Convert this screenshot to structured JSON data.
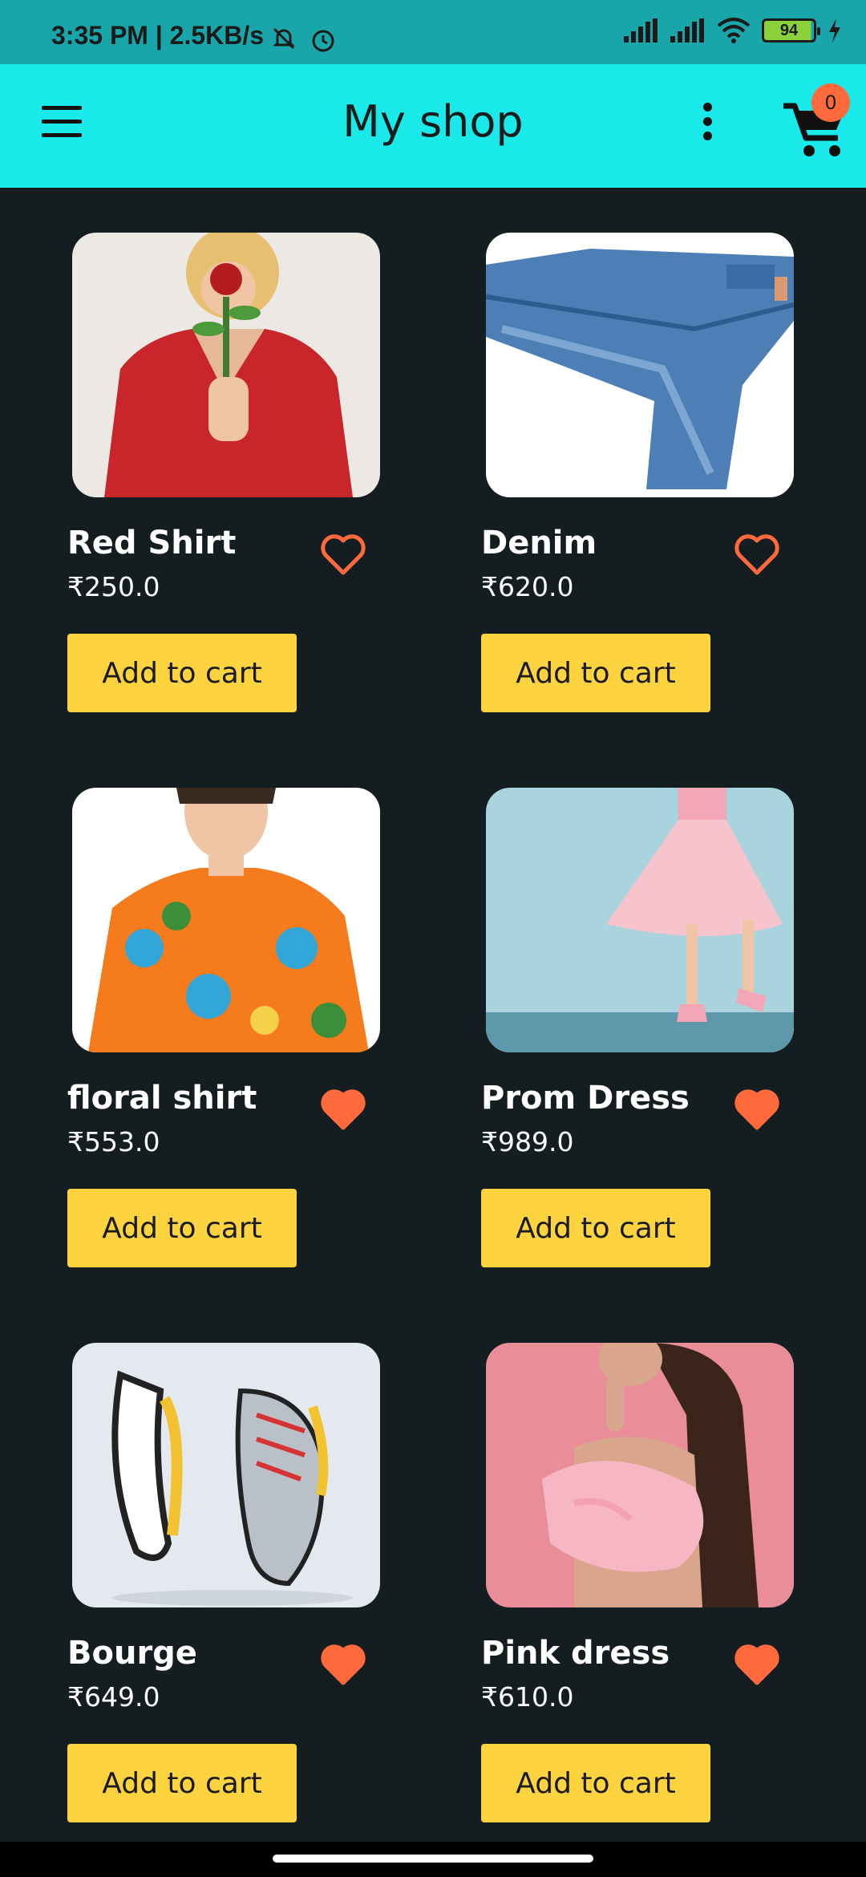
{
  "status_bar": {
    "time": "3:35 PM | 2.5KB/s",
    "battery": "94"
  },
  "app_bar": {
    "title": "My shop",
    "cart_count": "0"
  },
  "colors": {
    "app_bar": "#1ae9ea",
    "status_bar": "#18a6ab",
    "background": "#141d1f",
    "button": "#fdd33f",
    "accent": "#ff6a3d"
  },
  "products": [
    {
      "name": "Red Shirt",
      "price": "₹250.0",
      "button": "Add to cart",
      "favorite": false,
      "image": "man-in-red-shirt-holding-rose"
    },
    {
      "name": "Denim",
      "price": "₹620.0",
      "button": "Add to cart",
      "favorite": false,
      "image": "blue-denim-jeans"
    },
    {
      "name": "floral shirt",
      "price": "₹553.0",
      "button": "Add to cart",
      "favorite": true,
      "image": "man-in-floral-shirt"
    },
    {
      "name": "Prom Dress",
      "price": "₹989.0",
      "button": "Add to cart",
      "favorite": true,
      "image": "pink-prom-dress"
    },
    {
      "name": "Bourge",
      "price": "₹649.0",
      "button": "Add to cart",
      "favorite": true,
      "image": "sneakers"
    },
    {
      "name": "Pink dress",
      "price": "₹610.0",
      "button": "Add to cart",
      "favorite": true,
      "image": "woman-in-pink-dress"
    }
  ]
}
